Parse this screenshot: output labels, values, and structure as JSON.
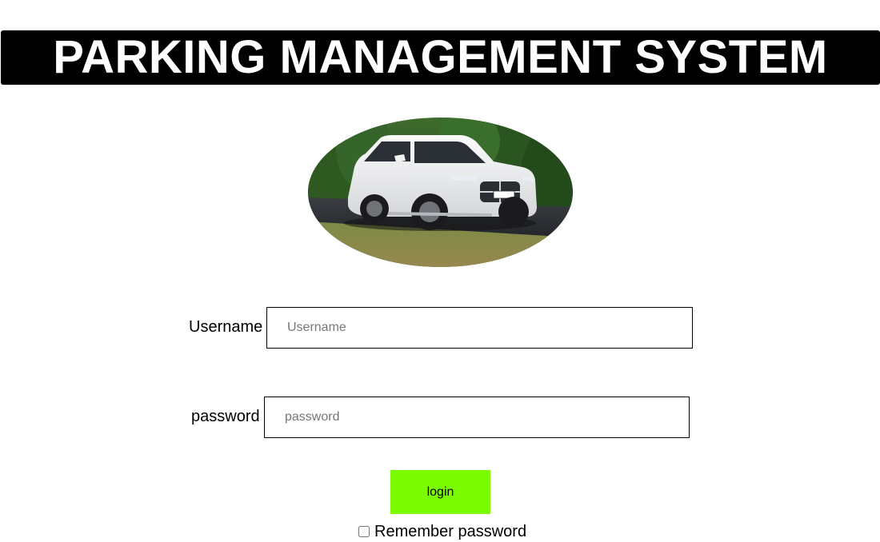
{
  "header": {
    "title": "PARKING MANAGEMENT SYSTEM"
  },
  "hero": {
    "icon": "car-photo"
  },
  "form": {
    "username_label": "Username",
    "username_placeholder": "Username",
    "username_value": "",
    "password_label": "password",
    "password_placeholder": "password",
    "password_value": "",
    "login_label": "login",
    "remember_label": "Remember password",
    "remember_checked": false
  },
  "colors": {
    "header_bg": "#000000",
    "header_text": "#ffffff",
    "login_bg": "#7cfc00"
  }
}
